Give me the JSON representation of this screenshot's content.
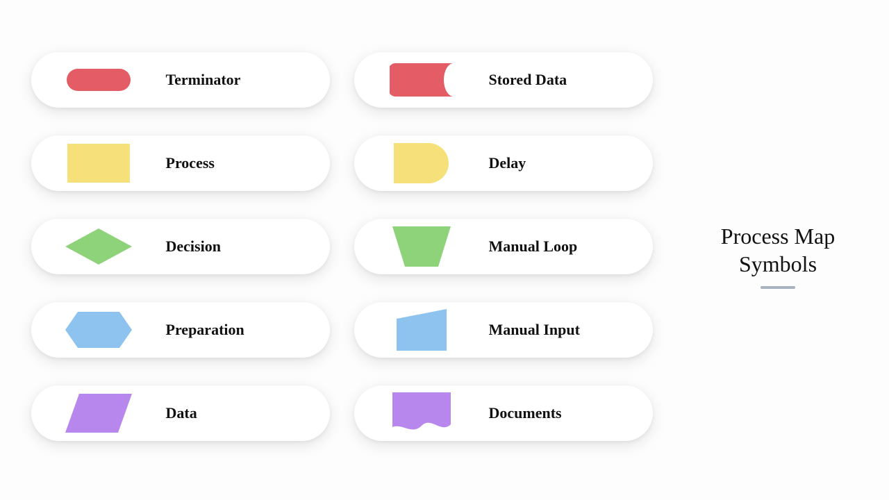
{
  "title_line1": "Process Map",
  "title_line2": "Symbols",
  "colors": {
    "red": "#e45d66",
    "yellow": "#f6e07a",
    "green": "#8ed37a",
    "blue": "#8fc3ef",
    "purple": "#b887ee"
  },
  "items": {
    "terminator": {
      "label": "Terminator",
      "shape": "terminator",
      "color": "red"
    },
    "process": {
      "label": "Process",
      "shape": "process",
      "color": "yellow"
    },
    "decision": {
      "label": "Decision",
      "shape": "decision",
      "color": "green"
    },
    "preparation": {
      "label": "Preparation",
      "shape": "preparation",
      "color": "blue"
    },
    "data": {
      "label": "Data",
      "shape": "data",
      "color": "purple"
    },
    "stored_data": {
      "label": "Stored Data",
      "shape": "stored_data",
      "color": "red"
    },
    "delay": {
      "label": "Delay",
      "shape": "delay",
      "color": "yellow"
    },
    "manual_loop": {
      "label": "Manual Loop",
      "shape": "manual_loop",
      "color": "green"
    },
    "manual_input": {
      "label": "Manual Input",
      "shape": "manual_input",
      "color": "blue"
    },
    "documents": {
      "label": "Documents",
      "shape": "documents",
      "color": "purple"
    }
  }
}
